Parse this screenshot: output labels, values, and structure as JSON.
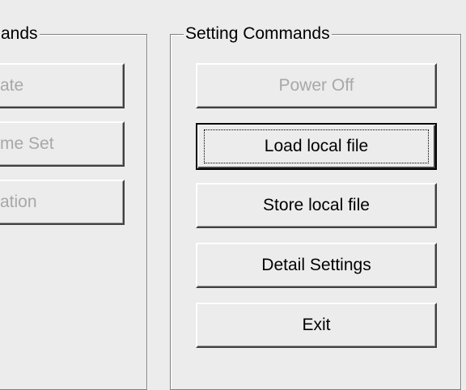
{
  "left_group": {
    "legend": "ands",
    "buttons": [
      {
        "label": "ate",
        "enabled": false
      },
      {
        "label": "me Set",
        "enabled": false
      },
      {
        "label": "ation",
        "enabled": false
      }
    ]
  },
  "right_group": {
    "legend": "Setting Commands",
    "buttons": [
      {
        "label": "Power Off",
        "enabled": false
      },
      {
        "label": "Load local file",
        "enabled": true,
        "focused": true
      },
      {
        "label": "Store local file",
        "enabled": true
      },
      {
        "label": "Detail Settings",
        "enabled": true
      },
      {
        "label": "Exit",
        "enabled": true
      }
    ]
  }
}
